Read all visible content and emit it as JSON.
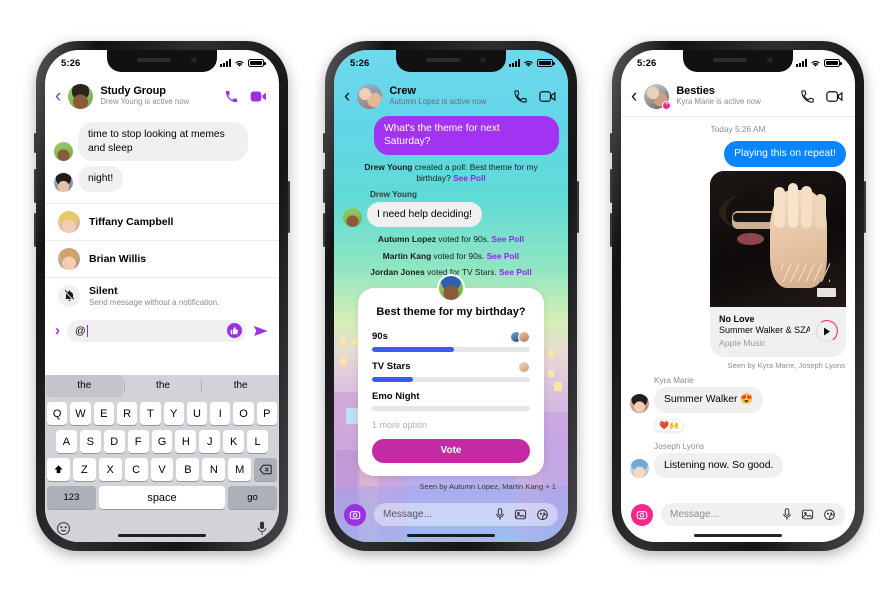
{
  "phones": [
    {
      "id": "study-group",
      "status": {
        "time": "5:26"
      },
      "header": {
        "title": "Study Group",
        "subtitle": "Drew Young is active now",
        "back_icon": "chevron-left-icon",
        "call_icon": "phone-icon",
        "video_icon": "video-camera-icon",
        "accent": "#9b30e0"
      },
      "messages": [
        {
          "text": "time to stop looking at memes and sleep",
          "side": "left",
          "style": "grey"
        },
        {
          "text": "night!",
          "side": "left",
          "style": "grey"
        }
      ],
      "mentions": [
        {
          "name": "Tiffany Campbell",
          "sub": ""
        },
        {
          "name": "Brian Willis",
          "sub": ""
        },
        {
          "name": "Silent",
          "sub": "Send message without a notification.",
          "icon": "bell-slash-icon"
        }
      ],
      "compose": {
        "chevron_icon": "chevron-right-icon",
        "value": "@",
        "thumbs_icon": "thumbs-up-icon",
        "send_icon": "send-arrow-icon"
      },
      "keyboard": {
        "predictions": [
          "the",
          "the",
          "the"
        ],
        "row1": [
          "Q",
          "W",
          "E",
          "R",
          "T",
          "Y",
          "U",
          "I",
          "O",
          "P"
        ],
        "row2": [
          "A",
          "S",
          "D",
          "F",
          "G",
          "H",
          "J",
          "K",
          "L"
        ],
        "row3": [
          "Z",
          "X",
          "C",
          "V",
          "B",
          "N",
          "M"
        ],
        "shift_icon": "shift-icon",
        "backspace_icon": "backspace-icon",
        "num_label": "123",
        "space_label": "space",
        "go_label": "go",
        "emoji_icon": "emoji-icon",
        "mic_icon": "microphone-icon"
      }
    },
    {
      "id": "crew",
      "status": {
        "time": "5:26"
      },
      "header": {
        "title": "Crew",
        "subtitle": "Autumn Lopez is active now",
        "back_icon": "chevron-left-icon",
        "call_icon": "phone-icon",
        "video_icon": "video-camera-icon",
        "accent": "#111111"
      },
      "outgoing_bubble": "What's the theme for next Saturday?",
      "system_lines": [
        {
          "actor": "Drew Young",
          "rest": " created a poll: Best theme for my birthday? ",
          "link": "See Poll"
        }
      ],
      "sender_label": "Drew Young",
      "incoming_bubble": "I need help deciding!",
      "votes": [
        {
          "actor": "Autumn Lopez",
          "rest": " voted for 90s. ",
          "link": "See Poll"
        },
        {
          "actor": "Martin Kang",
          "rest": " voted for 90s. ",
          "link": "See Poll"
        },
        {
          "actor": "Jordan Jones",
          "rest": " voted for TV Stars. ",
          "link": "See Poll"
        }
      ],
      "poll": {
        "question": "Best theme for my birthday?",
        "options": [
          {
            "label": "90s",
            "percent": 52,
            "voters": 2
          },
          {
            "label": "TV Stars",
            "percent": 26,
            "voters": 1
          },
          {
            "label": "Emo Night",
            "percent": 0,
            "voters": 0
          }
        ],
        "more_options": "1 more option",
        "vote_label": "Vote",
        "bar_color": "#3b5bf0",
        "button_color": "#c32aa3"
      },
      "seen": "Seen by Autumn Lopez, Martin Kang + 1",
      "compose": {
        "camera_icon": "camera-icon",
        "placeholder": "Message...",
        "mic_icon": "microphone-icon",
        "gallery_icon": "photo-icon",
        "sticker_icon": "sticker-icon",
        "camera_color": "#9b30e0"
      }
    },
    {
      "id": "besties",
      "status": {
        "time": "5:26"
      },
      "header": {
        "title": "Besties",
        "subtitle": "Kyra Marie is active now",
        "back_icon": "chevron-left-icon",
        "call_icon": "phone-icon",
        "video_icon": "video-camera-icon",
        "accent": "#111111"
      },
      "daystamp": "Today 5:26 AM",
      "outgoing_bubble": "Playing this on repeat!",
      "music": {
        "title": "No Love",
        "artist": "Summer Walker & SZA",
        "source": "Apple Music",
        "play_icon": "play-icon"
      },
      "seen": "Seen by Kyra Marie, Joseph Lyons",
      "replies": [
        {
          "sender": "Kyra Marie",
          "text": "Summer Walker 😍",
          "reactions": "❤️🙌"
        },
        {
          "sender": "Joseph Lyons",
          "text": "Listening now. So good.",
          "reactions": ""
        }
      ],
      "compose": {
        "camera_icon": "camera-icon",
        "placeholder": "Message...",
        "mic_icon": "microphone-icon",
        "gallery_icon": "photo-icon",
        "sticker_icon": "sticker-icon",
        "camera_color": "#f7268b"
      }
    }
  ]
}
